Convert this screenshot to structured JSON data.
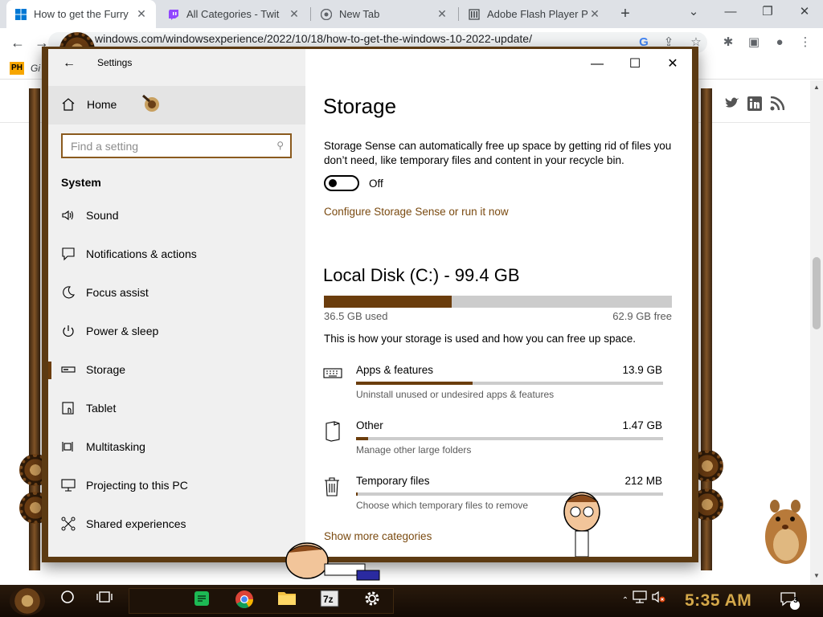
{
  "browser": {
    "tabs": [
      {
        "title": "How to get the Furry",
        "favicon": "windows-logo",
        "active": true
      },
      {
        "title": "All Categories - Twit",
        "favicon": "twitch-icon",
        "active": false
      },
      {
        "title": "New Tab",
        "favicon": "chrome-icon",
        "active": false
      },
      {
        "title": "Adobe Flash Player Pr",
        "favicon": "archive-icon",
        "active": false
      }
    ],
    "url": "windows.com/windowsexperience/2022/10/18/how-to-get-the-windows-10-2022-update/",
    "bookmark": {
      "badge": "PH",
      "label": "Gi"
    }
  },
  "settings": {
    "app_title": "Settings",
    "home_label": "Home",
    "search_placeholder": "Find a setting",
    "group_title": "System",
    "nav": [
      {
        "label": "Sound",
        "icon": "speaker-icon"
      },
      {
        "label": "Notifications & actions",
        "icon": "notification-icon"
      },
      {
        "label": "Focus assist",
        "icon": "moon-icon"
      },
      {
        "label": "Power & sleep",
        "icon": "power-icon"
      },
      {
        "label": "Storage",
        "icon": "drive-icon",
        "selected": true
      },
      {
        "label": "Tablet",
        "icon": "tablet-icon"
      },
      {
        "label": "Multitasking",
        "icon": "multitasking-icon"
      },
      {
        "label": "Projecting to this PC",
        "icon": "projector-icon"
      },
      {
        "label": "Shared experiences",
        "icon": "share-icon"
      }
    ],
    "page_title": "Storage",
    "description": "Storage Sense can automatically free up space by getting rid of files you don’t need, like temporary files and content in your recycle bin.",
    "toggle_state": "Off",
    "configure_link": "Configure Storage Sense or run it now",
    "disk": {
      "title": "Local Disk (C:) - 99.4 GB",
      "used_label": "36.5 GB used",
      "free_label": "62.9 GB free",
      "used_fraction": 0.367
    },
    "storage_note": "This is how your storage is used and how you can free up space.",
    "categories": [
      {
        "name": "Apps & features",
        "size": "13.9 GB",
        "desc": "Uninstall unused or undesired apps & features",
        "fill": 0.38,
        "icon": "keyboard-icon"
      },
      {
        "name": "Other",
        "size": "1.47 GB",
        "desc": "Manage other large folders",
        "fill": 0.04,
        "icon": "folder-icon"
      },
      {
        "name": "Temporary files",
        "size": "212 MB",
        "desc": "Choose which temporary files to remove",
        "fill": 0.005,
        "icon": "trash-icon"
      }
    ],
    "more_link": "Show more categories"
  },
  "taskbar": {
    "clock": "5:35 AM",
    "notification_count": "3"
  },
  "colors": {
    "accent": "#6b3d0d",
    "link": "#7a4a10",
    "window_border": "#5c3a12",
    "clock": "#d4a84a"
  }
}
